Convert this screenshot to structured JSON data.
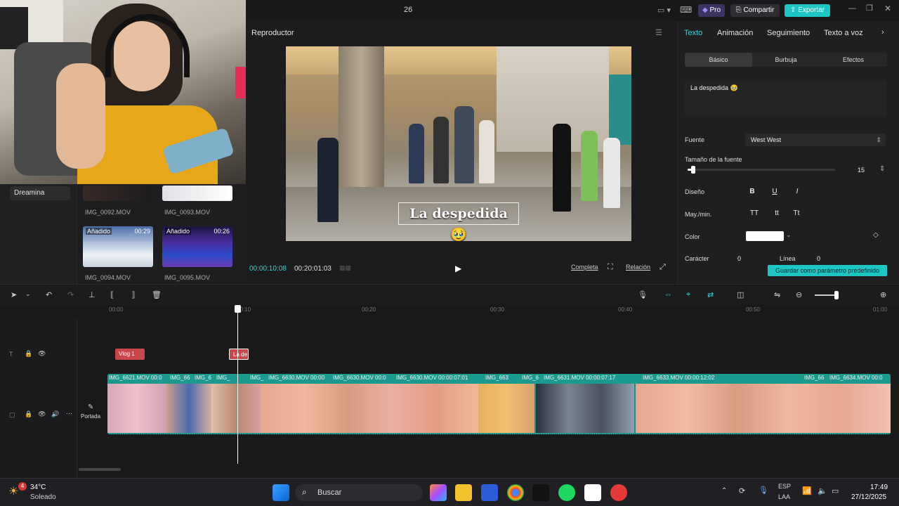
{
  "topbar": {
    "title": "26",
    "pro_label": "Pro",
    "share_label": "Compartir",
    "export_label": "Exportar"
  },
  "media": {
    "sidebar_item": "Dreamina",
    "thumbs": [
      {
        "caption": "IMG_0092.MOV",
        "tag": "",
        "duration": ""
      },
      {
        "caption": "IMG_0093.MOV",
        "tag": "",
        "duration": ""
      },
      {
        "caption": "IMG_0094.MOV",
        "tag": "Añadido",
        "duration": "00:29"
      },
      {
        "caption": "IMG_0095.MOV",
        "tag": "Añadido",
        "duration": "00:26"
      }
    ]
  },
  "player": {
    "title": "Reproductor",
    "caption": "La despedida 🥹",
    "current_time": "00:00:10:08",
    "total_time": "00:20:01:03",
    "full_label": "Completa",
    "ratio_label": "Relación"
  },
  "panel": {
    "tabs": [
      "Texto",
      "Animación",
      "Seguimiento",
      "Texto a voz"
    ],
    "subtabs": [
      "Básico",
      "Burbuja",
      "Efectos"
    ],
    "text_value": "La despedida 🥹",
    "font_label": "Fuente",
    "font_value": "West West",
    "size_label": "Tamaño de la fuente",
    "size_value": "15",
    "size_fraction": 0.04,
    "design_label": "Diseño",
    "case_label": "May./min.",
    "case_options": [
      "TT",
      "tt",
      "Tt"
    ],
    "color_label": "Color",
    "color_value": "#ffffff",
    "char_label": "Carácter",
    "char_value": "0",
    "line_label": "Línea",
    "line_value": "0",
    "save_label": "Guardar como parámetro predefinido"
  },
  "timeline": {
    "ruler": [
      "00:00",
      "00:10",
      "00:20",
      "00:30",
      "00:40",
      "00:50",
      "01:00"
    ],
    "text_clip_1": "Vlog 1",
    "text_clip_2": "La de",
    "cover_label": "Portada",
    "video_names": [
      "IMG_6621.MOV  00:0",
      "IMG_66",
      "IMG_6",
      "IMG_",
      "IMG_",
      "IMG_6630.MOV  00:00",
      "IMG_6630.MOV  00:0",
      "IMG_6630.MOV  00:00:07:01",
      "IMG_663",
      "IMG_6",
      "IMG_6631.MOV  00:00:07:17",
      "IMG_6633.MOV  00:00:12:02",
      "IMG_66",
      "IMG_6634.MOV  00:0"
    ]
  },
  "taskbar": {
    "weather_badge": "4",
    "temperature": "34°C",
    "condition": "Soleado",
    "search_label": "Buscar",
    "lang": "ESP",
    "region": "LAA",
    "time": "17:49",
    "date": "27/12/2025"
  }
}
